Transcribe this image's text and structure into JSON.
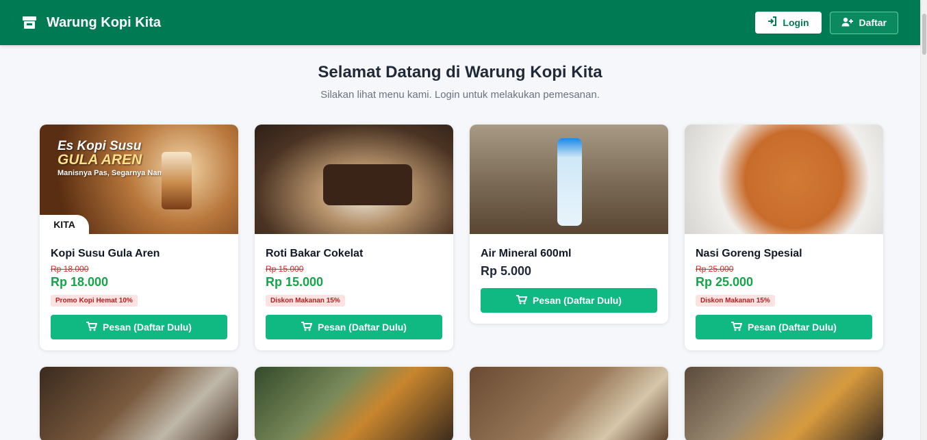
{
  "navbar": {
    "brand": "Warung Kopi Kita",
    "login_label": "Login",
    "daftar_label": "Daftar"
  },
  "hero": {
    "title": "Selamat Datang di Warung Kopi Kita",
    "subtitle": "Silakan lihat menu kami. Login untuk melakukan pemesanan."
  },
  "menu": [
    {
      "name": "Kopi Susu Gula Aren",
      "old_price": "Rp 18.000",
      "price": "Rp 18.000",
      "badge": "Promo Kopi Hemat 10%",
      "button": "Pesan (Daftar Dulu)",
      "image_promo": {
        "line1": "Es Kopi Susu",
        "line2": "GULA AREN",
        "line3": "Manisnya Pas, Segarnya Nampol!",
        "logo": "KITA"
      }
    },
    {
      "name": "Roti Bakar Cokelat",
      "old_price": "Rp 15.000",
      "price": "Rp 15.000",
      "badge": "Diskon Makanan 15%",
      "button": "Pesan (Daftar Dulu)"
    },
    {
      "name": "Air Mineral 600ml",
      "price": "Rp 5.000",
      "button": "Pesan (Daftar Dulu)"
    },
    {
      "name": "Nasi Goreng Spesial",
      "old_price": "Rp 25.000",
      "price": "Rp 25.000",
      "badge": "Diskon Makanan 15%",
      "button": "Pesan (Daftar Dulu)"
    }
  ],
  "colors": {
    "navbar": "#007a52",
    "accent": "#10b981",
    "price_green": "#16a34a",
    "strike_red": "#dc2626",
    "badge_bg": "#fde2e2"
  },
  "icons": {
    "brand": "store-icon",
    "login": "sign-in-icon",
    "daftar": "user-plus-icon",
    "order": "cart-icon"
  }
}
